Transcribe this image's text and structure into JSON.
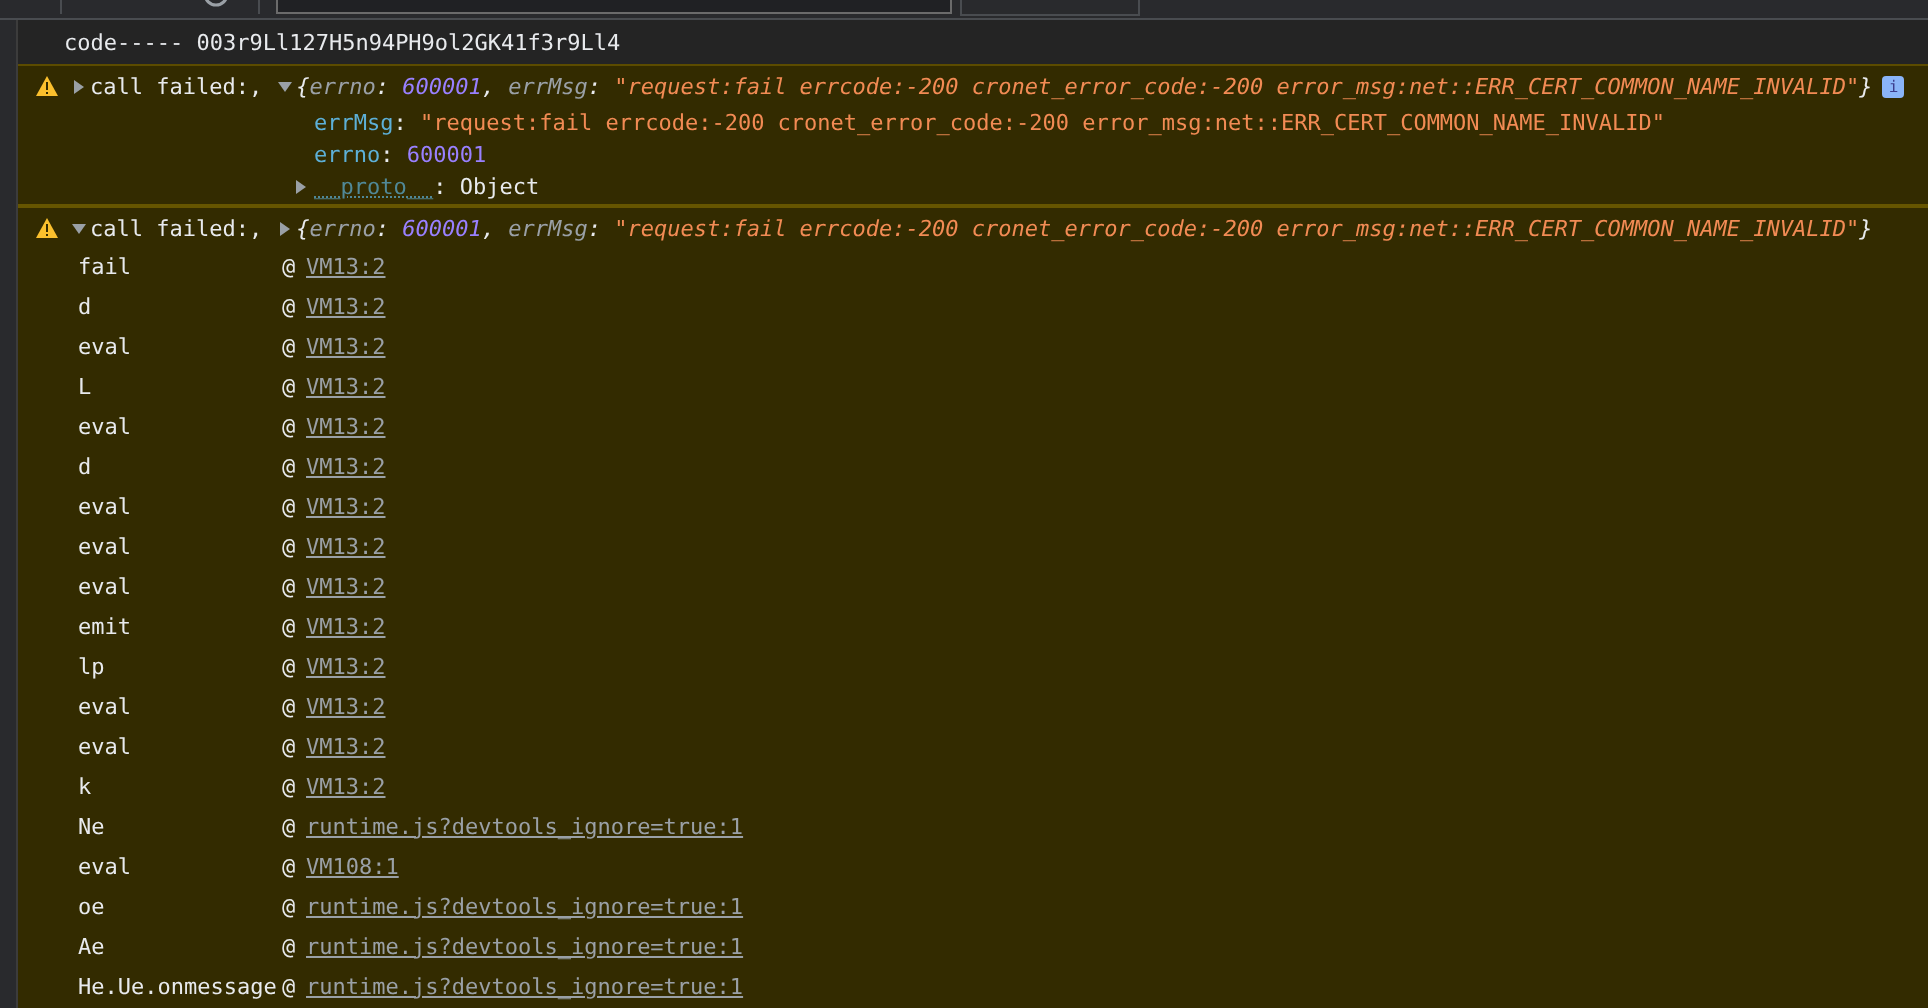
{
  "log_line": "code----- 003r9Ll127H5n94PH9ol2GK41f3r9Ll4",
  "messages": [
    {
      "label": "call failed:,",
      "expanded": false,
      "object": {
        "expanded": true,
        "info_badge": "i",
        "summary": [
          {
            "kind": "punct",
            "text": "{"
          },
          {
            "kind": "key",
            "text": "errno"
          },
          {
            "kind": "punct",
            "text": ": "
          },
          {
            "kind": "number",
            "text": "600001"
          },
          {
            "kind": "punct",
            "text": ", "
          },
          {
            "kind": "key",
            "text": "errMsg"
          },
          {
            "kind": "punct",
            "text": ": "
          },
          {
            "kind": "string",
            "text": "\"request:fail errcode:-200 cronet_error_code:-200 error_msg:net::ERR_CERT_COMMON_NAME_INVALID\""
          },
          {
            "kind": "punct",
            "text": "}"
          }
        ],
        "properties": [
          {
            "kind": "string",
            "key": "errMsg",
            "sep": ": ",
            "value": "\"request:fail errcode:-200 cronet_error_code:-200 error_msg:net::ERR_CERT_COMMON_NAME_INVALID\""
          },
          {
            "kind": "number",
            "key": "errno",
            "sep": ": ",
            "value": "600001"
          },
          {
            "kind": "proto",
            "key": "__proto__",
            "sep": ": ",
            "value": "Object",
            "expanded": false
          }
        ]
      }
    },
    {
      "label": "call failed:,",
      "expanded": true,
      "object": {
        "expanded": false,
        "summary": [
          {
            "kind": "punct",
            "text": "{"
          },
          {
            "kind": "key",
            "text": "errno"
          },
          {
            "kind": "punct",
            "text": ": "
          },
          {
            "kind": "number",
            "text": "600001"
          },
          {
            "kind": "punct",
            "text": ", "
          },
          {
            "kind": "key",
            "text": "errMsg"
          },
          {
            "kind": "punct",
            "text": ": "
          },
          {
            "kind": "string",
            "text": "\"request:fail errcode:-200 cronet_error_code:-200 error_msg:net::ERR_CERT_COMMON_NAME_INVALID\""
          },
          {
            "kind": "punct",
            "text": "}"
          }
        ]
      },
      "stack": [
        {
          "fn": "fail",
          "at": "@",
          "src": "VM13:2"
        },
        {
          "fn": "d",
          "at": "@",
          "src": "VM13:2"
        },
        {
          "fn": "eval",
          "at": "@",
          "src": "VM13:2"
        },
        {
          "fn": "L",
          "at": "@",
          "src": "VM13:2"
        },
        {
          "fn": "eval",
          "at": "@",
          "src": "VM13:2"
        },
        {
          "fn": "d",
          "at": "@",
          "src": "VM13:2"
        },
        {
          "fn": "eval",
          "at": "@",
          "src": "VM13:2"
        },
        {
          "fn": "eval",
          "at": "@",
          "src": "VM13:2"
        },
        {
          "fn": "eval",
          "at": "@",
          "src": "VM13:2"
        },
        {
          "fn": "emit",
          "at": "@",
          "src": "VM13:2"
        },
        {
          "fn": "lp",
          "at": "@",
          "src": "VM13:2"
        },
        {
          "fn": "eval",
          "at": "@",
          "src": "VM13:2"
        },
        {
          "fn": "eval",
          "at": "@",
          "src": "VM13:2"
        },
        {
          "fn": "k",
          "at": "@",
          "src": "VM13:2"
        },
        {
          "fn": "Ne",
          "at": "@",
          "src": "runtime.js?devtools_ignore=true:1"
        },
        {
          "fn": "eval",
          "at": "@",
          "src": "VM108:1"
        },
        {
          "fn": "oe",
          "at": "@",
          "src": "runtime.js?devtools_ignore=true:1"
        },
        {
          "fn": "Ae",
          "at": "@",
          "src": "runtime.js?devtools_ignore=true:1"
        },
        {
          "fn": "He.Ue.onmessage",
          "at": "@",
          "src": "runtime.js?devtools_ignore=true:1"
        }
      ]
    }
  ]
}
